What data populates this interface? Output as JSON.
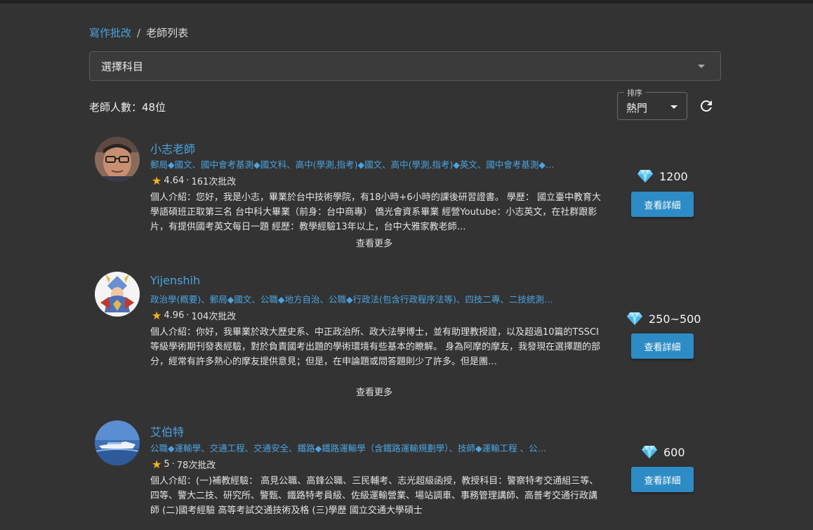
{
  "breadcrumb": {
    "parent": "寫作批改",
    "separator": "/",
    "current": "老師列表"
  },
  "subject_select": {
    "placeholder": "選擇科目"
  },
  "teacher_count": "老師人數：48位",
  "sort": {
    "label": "排序",
    "value": "熱門"
  },
  "detail_label": "查看詳細",
  "more_label": "查看更多",
  "teachers": [
    {
      "name": "小志老師",
      "tags": "郵局◆國文、國中會考基測◆國文科、高中(學測,指考)◆國文、高中(學測,指考)◆英文、國中會考基測◆…",
      "rating": "4.64",
      "reviews": "161次批改",
      "intro": "個人介紹：您好，我是小志，畢業於台中技術學院，有18小時+6小時的課後研習證書。 學歷： 國立臺中教育大學語碩班正取第三名 台中科大畢業（前身：台中商專） 僑光會資系畢業 經營Youtube：小志英文，在社群跟影片，有提供國考英文每日一題 經歷：教學經驗13年以上，台中大雅家教老師…",
      "price": "1200"
    },
    {
      "name": "Yijenshih",
      "tags": "政治學(概要)、郵局◆國文、公職◆地方自治、公職◆行政法(包含行政程序法等)、四技二專、二技統測…",
      "rating": "4.96",
      "reviews": "104次批改",
      "intro": "個人介紹：你好，我畢業於政大歷史系、中正政治所、政大法學博士，並有助理教授證，以及超過10篇的TSSCI等級學術期刊發表經驗，對於負責國考出題的學術環境有些基本的瞭解。 身為阿摩的摩友，我發現在選擇題的部分，經常有許多熱心的摩友提供意見；但是，在申論題或問答題則少了許多。但是團…",
      "price": "250~500"
    },
    {
      "name": "艾伯特",
      "tags": "公職◆運輸學、交通工程、交通安全、鐵路◆鐵路運輸學（含鐵路運輸規劃學）、技師◆運輸工程 、公…",
      "rating": "5",
      "reviews": "78次批改",
      "intro": "個人介紹：(一)補教經驗： 高見公職、高鋒公職、三民輔考、志光超級函授，教授科目：警察特考交通組三等、四等、警大二技、研究所、警甄、鐵路特考員級、佐級運輸營業、場站調車、事務管理講師、高普考交通行政講師 (二)國考經驗 高等考試交通技術及格 (三)學歷 國立交通大學碩士",
      "price": "600"
    }
  ]
}
